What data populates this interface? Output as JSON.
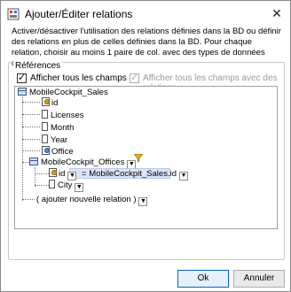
{
  "dialog": {
    "title": "Ajouter/Éditer relations",
    "close_glyph": "✕",
    "description": "Activer/désactiver l'utilisation des relations définies dans la BD ou définir des relations en plus de celles définies dans la BD. Pour chaque relation, choisir au moins 1 paire de col. avec des types de données corr."
  },
  "references": {
    "group_label": "Références",
    "show_all_fields_label": "Afficher tous les champs",
    "show_all_fields_checked": true,
    "show_all_fields_with_relations_label": "Afficher tous les champs avec des relations",
    "show_all_fields_with_relations_checked": true
  },
  "tree": {
    "root_table": "MobileCockpit_Sales",
    "fields": [
      "id",
      "Licenses",
      "Month",
      "Year",
      "Office"
    ],
    "related_table": "MobileCockpit_Offices",
    "related_fields": [
      {
        "name": "id",
        "relation": "= MobileCockpit_Sales.id"
      },
      {
        "name": "City"
      }
    ],
    "add_relation_label": "( ajouter nouvelle relation )"
  },
  "buttons": {
    "ok": "Ok",
    "cancel": "Annuler"
  },
  "colors": {
    "relation_highlight": "#dbe5f7",
    "primary_button_border": "#0a64c8",
    "filter_icon": "#e8a200"
  }
}
